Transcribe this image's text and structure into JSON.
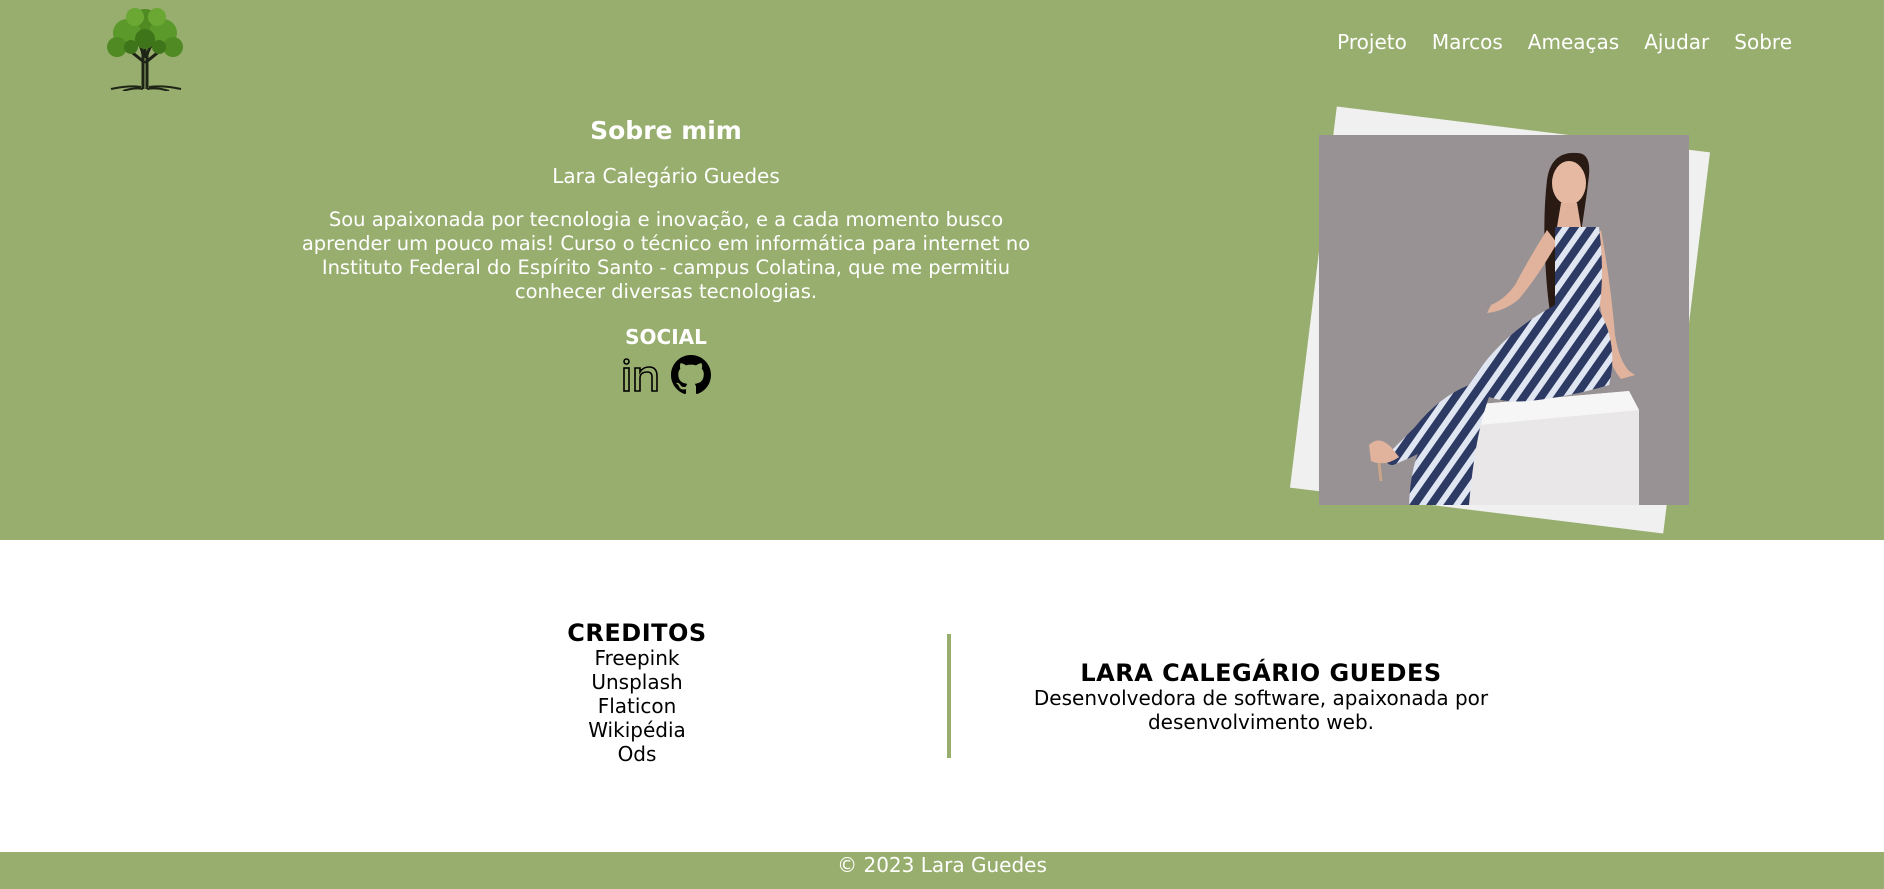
{
  "colors": {
    "primary": "#98ae6e",
    "white": "#ffffff",
    "photo_frame": "#f0f0f0"
  },
  "nav": {
    "items": [
      {
        "label": "Projeto"
      },
      {
        "label": "Marcos"
      },
      {
        "label": "Ameaças"
      },
      {
        "label": "Ajudar"
      },
      {
        "label": "Sobre"
      }
    ]
  },
  "about": {
    "title": "Sobre mim",
    "name": "Lara Calegário Guedes",
    "bio": "Sou apaixonada por tecnologia e inovação, e a cada momento busco aprender um pouco mais! Curso o técnico em informática para internet no Instituto Federal do Espírito Santo - campus Colatina, que me permitiu conhecer diversas tecnologias.",
    "social_title": "SOCIAL",
    "social_icons": [
      "linkedin-icon",
      "github-icon"
    ]
  },
  "credits": {
    "title": "CREDITOS",
    "items": [
      "Freepink",
      "Unsplash",
      "Flaticon",
      "Wikipédia",
      "Ods"
    ]
  },
  "author": {
    "title": "LARA CALEGÁRIO GUEDES",
    "description": "Desenvolvedora de software, apaixonada por desenvolvimento web."
  },
  "footer": {
    "copyright": "© 2023 Lara Guedes"
  }
}
